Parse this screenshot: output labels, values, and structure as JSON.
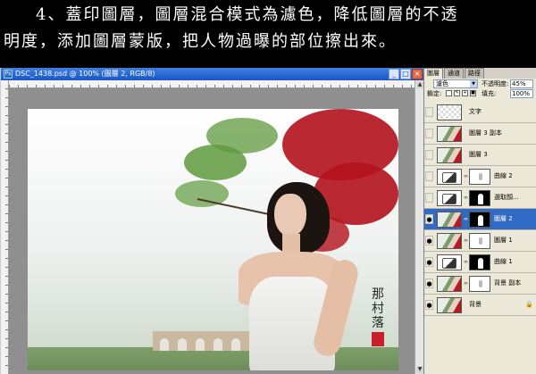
{
  "banner": {
    "line1": "4、蓋印圖層，圖層混合模式為濾色，降低圖層的不透",
    "line2": "明度，添加圖層蒙版，把人物過曝的部位擦出來。"
  },
  "document": {
    "title": "DSC_1438.psd @ 100% (圖層 2, RGB/8)",
    "app_icon": "photoshop-icon",
    "photo_signature": "那村落",
    "window_buttons": {
      "minimize": "_",
      "maximize": "□",
      "close": "×"
    }
  },
  "panel": {
    "tabs": [
      {
        "label": "圖層",
        "active": true
      },
      {
        "label": "通道",
        "active": false
      },
      {
        "label": "路徑",
        "active": false
      }
    ],
    "blend_mode": "濾色",
    "opacity_label": "不透明度:",
    "opacity_value": "45%",
    "lock_label": "鎖定:",
    "fill_label": "填充:",
    "fill_value": "100%"
  },
  "layers": [
    {
      "name": "文字",
      "thumb": "checker",
      "mask": null,
      "visible": false,
      "selected": false
    },
    {
      "name": "圖層 3 副本",
      "thumb": "photo",
      "mask": null,
      "visible": false,
      "selected": false
    },
    {
      "name": "圖層 3",
      "thumb": "photo",
      "mask": null,
      "visible": false,
      "selected": false
    },
    {
      "name": "曲線 2",
      "thumb": "adjust",
      "mask": "white",
      "visible": false,
      "selected": false
    },
    {
      "name": "選取顏...",
      "thumb": "adjust",
      "mask": "black",
      "visible": false,
      "selected": false
    },
    {
      "name": "圖層 2",
      "thumb": "photo",
      "mask": "black",
      "visible": true,
      "selected": true
    },
    {
      "name": "圖層 1",
      "thumb": "photo",
      "mask": "white",
      "visible": true,
      "selected": false
    },
    {
      "name": "曲線 1",
      "thumb": "adjust",
      "mask": "black",
      "visible": true,
      "selected": false
    },
    {
      "name": "背景 副本",
      "thumb": "photo",
      "mask": "white",
      "visible": true,
      "selected": false
    },
    {
      "name": "背景",
      "thumb": "photo",
      "mask": null,
      "visible": true,
      "selected": false,
      "locked": true
    }
  ]
}
